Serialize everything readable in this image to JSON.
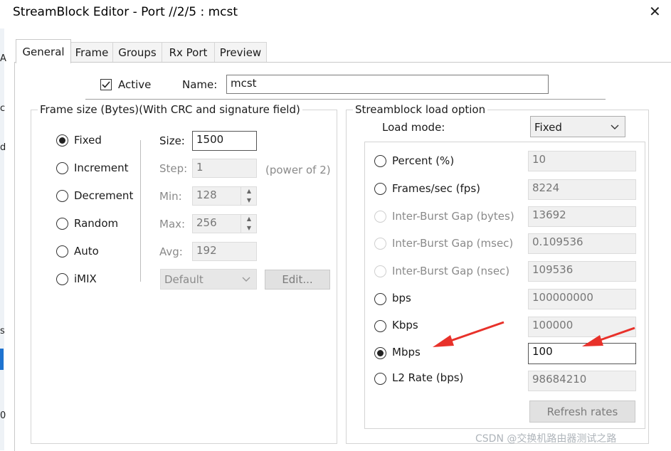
{
  "window": {
    "title": "StreamBlock Editor - Port //2/5 : mcst"
  },
  "left_fragments": [
    "A",
    "c",
    "d",
    "s",
    "0"
  ],
  "tabs": [
    {
      "label": "General",
      "active": true
    },
    {
      "label": "Frame",
      "active": false
    },
    {
      "label": "Groups",
      "active": false
    },
    {
      "label": "Rx Port",
      "active": false
    },
    {
      "label": "Preview",
      "active": false
    }
  ],
  "general": {
    "active_label": "Active",
    "active_checked": true,
    "name_label": "Name:",
    "name_value": "mcst"
  },
  "frame_size": {
    "title": "Frame size (Bytes)(With CRC and signature field)",
    "modes": [
      {
        "label": "Fixed",
        "selected": true
      },
      {
        "label": "Increment",
        "selected": false
      },
      {
        "label": "Decrement",
        "selected": false
      },
      {
        "label": "Random",
        "selected": false
      },
      {
        "label": "Auto",
        "selected": false
      },
      {
        "label": "iMIX",
        "selected": false
      }
    ],
    "size_label": "Size:",
    "size_value": "1500",
    "step_label": "Step:",
    "step_value": "1",
    "step_hint": "(power of 2)",
    "min_label": "Min:",
    "min_value": "128",
    "max_label": "Max:",
    "max_value": "256",
    "avg_label": "Avg:",
    "avg_value": "192",
    "imix_select": "Default",
    "edit_button": "Edit..."
  },
  "load": {
    "title": "Streamblock load option",
    "mode_label": "Load mode:",
    "mode_value": "Fixed",
    "options": [
      {
        "label": "Percent (%)",
        "value": "10",
        "selected": false,
        "enabled": true,
        "editable": false
      },
      {
        "label": "Frames/sec (fps)",
        "value": "8224",
        "selected": false,
        "enabled": true,
        "editable": false
      },
      {
        "label": "Inter-Burst Gap (bytes)",
        "value": "13692",
        "selected": false,
        "enabled": false,
        "editable": false
      },
      {
        "label": "Inter-Burst Gap (msec)",
        "value": "0.109536",
        "selected": false,
        "enabled": false,
        "editable": false
      },
      {
        "label": "Inter-Burst Gap (nsec)",
        "value": "109536",
        "selected": false,
        "enabled": false,
        "editable": false
      },
      {
        "label": "bps",
        "value": "100000000",
        "selected": false,
        "enabled": true,
        "editable": false
      },
      {
        "label": "Kbps",
        "value": "100000",
        "selected": false,
        "enabled": true,
        "editable": false
      },
      {
        "label": "Mbps",
        "value": "100",
        "selected": true,
        "enabled": true,
        "editable": true
      },
      {
        "label": "L2 Rate (bps)",
        "value": "98684210",
        "selected": false,
        "enabled": true,
        "editable": false
      }
    ],
    "refresh_button": "Refresh rates"
  },
  "annotation_color": "#e8312a",
  "watermark": "CSDN @交换机路由器测试之路"
}
